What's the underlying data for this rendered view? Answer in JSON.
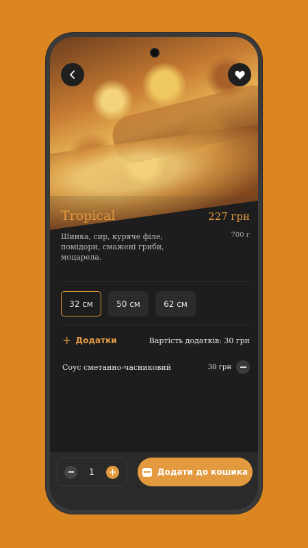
{
  "product": {
    "name": "Tropical",
    "price": "227 грн",
    "description": "Шинка, сир, куряче філе, помідори, смажені гриби, моцарела.",
    "weight": "700 г"
  },
  "sizes": [
    {
      "label": "32 см",
      "selected": true
    },
    {
      "label": "50 см",
      "selected": false
    },
    {
      "label": "62 см",
      "selected": false
    }
  ],
  "addons": {
    "button_label": "Додатки",
    "cost_label": "Вартість додатків: 30 грн",
    "items": [
      {
        "name": "Соус сметанно-часниковий",
        "price": "30 грн"
      }
    ]
  },
  "quantity": "1",
  "cart": {
    "label": "Додати до кошика"
  },
  "icons": {
    "back": "chevron-left-icon",
    "favorite": "heart-icon",
    "cart": "cart-icon"
  },
  "colors": {
    "accent": "#E39A3E",
    "background": "#DC8622",
    "screen": "#1D1D1D"
  }
}
